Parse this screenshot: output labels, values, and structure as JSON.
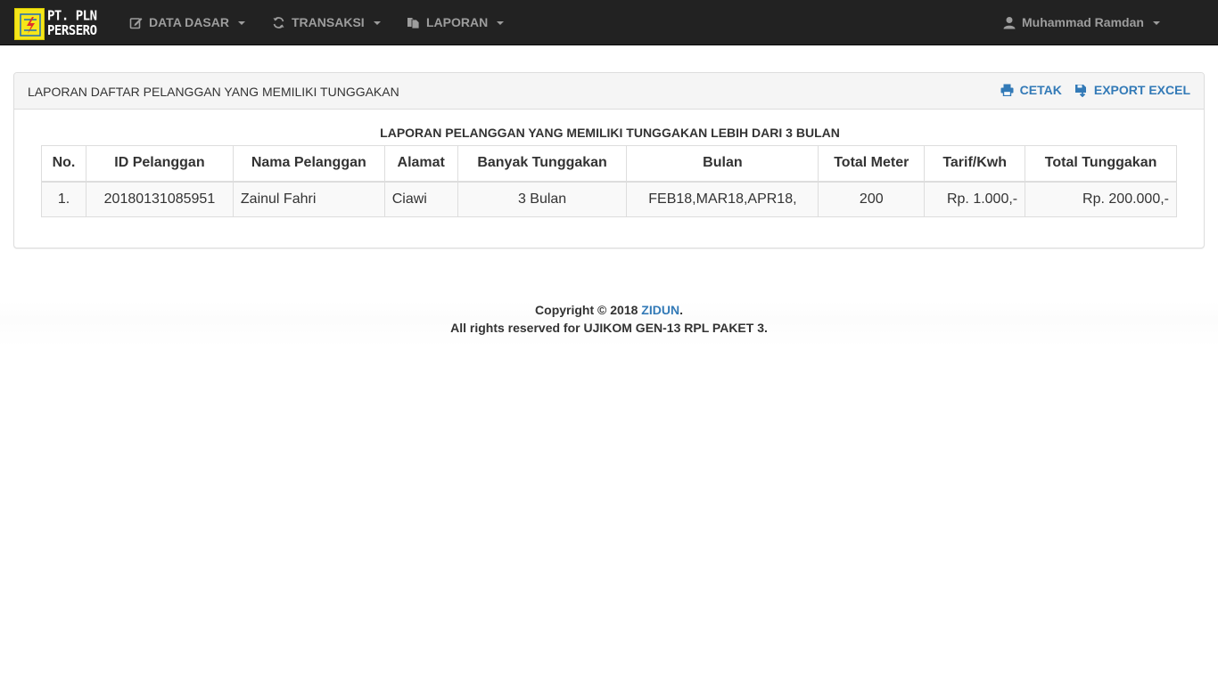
{
  "brand": {
    "line1": "PT. PLN",
    "line2": "PERSERO",
    "logo_icon": "pln-lightning-logo"
  },
  "nav": {
    "items": [
      {
        "label": "DATA DASAR",
        "icon": "edit-icon"
      },
      {
        "label": "TRANSAKSI",
        "icon": "refresh-icon"
      },
      {
        "label": "LAPORAN",
        "icon": "documents-icon"
      }
    ],
    "user": {
      "label": "Muhammad Ramdan",
      "icon": "user-icon"
    }
  },
  "panel": {
    "title": "LAPORAN DAFTAR PELANGGAN YANG MEMILIKI TUNGGAKAN",
    "actions": {
      "print_label": "CETAK",
      "export_label": "EXPORT EXCEL"
    },
    "report_title": "LAPORAN PELANGGAN YANG MEMILIKI TUNGGAKAN LEBIH DARI 3 BULAN"
  },
  "table": {
    "headers": [
      "No.",
      "ID Pelanggan",
      "Nama Pelanggan",
      "Alamat",
      "Banyak Tunggakan",
      "Bulan",
      "Total Meter",
      "Tarif/Kwh",
      "Total Tunggakan"
    ],
    "rows": [
      [
        "1.",
        "20180131085951",
        "Zainul Fahri",
        "Ciawi",
        "3 Bulan",
        "FEB18,MAR18,APR18,",
        "200",
        "Rp. 1.000,-",
        "Rp. 200.000,-"
      ]
    ]
  },
  "footer": {
    "copyright_prefix": "Copyright © 2018 ",
    "copyright_link": "ZIDUN",
    "copyright_suffix": ".",
    "rights": "All rights reserved for UJIKOM GEN-13 RPL PAKET 3."
  },
  "colors": {
    "navbar_bg": "#222222",
    "nav_text": "#9d9d9d",
    "link": "#337ab7",
    "logo_yellow": "#f5e61a"
  }
}
